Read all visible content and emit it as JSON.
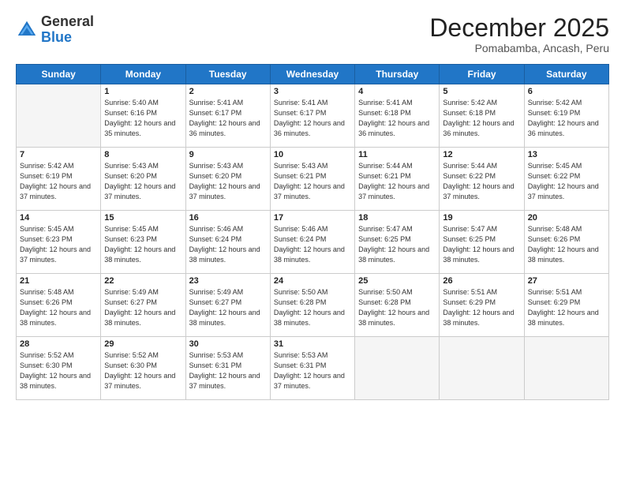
{
  "logo": {
    "general": "General",
    "blue": "Blue"
  },
  "title": "December 2025",
  "subtitle": "Pomabamba, Ancash, Peru",
  "days_of_week": [
    "Sunday",
    "Monday",
    "Tuesday",
    "Wednesday",
    "Thursday",
    "Friday",
    "Saturday"
  ],
  "weeks": [
    [
      {
        "day": "",
        "sunrise": "",
        "sunset": "",
        "daylight": ""
      },
      {
        "day": "1",
        "sunrise": "Sunrise: 5:40 AM",
        "sunset": "Sunset: 6:16 PM",
        "daylight": "Daylight: 12 hours and 35 minutes."
      },
      {
        "day": "2",
        "sunrise": "Sunrise: 5:41 AM",
        "sunset": "Sunset: 6:17 PM",
        "daylight": "Daylight: 12 hours and 36 minutes."
      },
      {
        "day": "3",
        "sunrise": "Sunrise: 5:41 AM",
        "sunset": "Sunset: 6:17 PM",
        "daylight": "Daylight: 12 hours and 36 minutes."
      },
      {
        "day": "4",
        "sunrise": "Sunrise: 5:41 AM",
        "sunset": "Sunset: 6:18 PM",
        "daylight": "Daylight: 12 hours and 36 minutes."
      },
      {
        "day": "5",
        "sunrise": "Sunrise: 5:42 AM",
        "sunset": "Sunset: 6:18 PM",
        "daylight": "Daylight: 12 hours and 36 minutes."
      },
      {
        "day": "6",
        "sunrise": "Sunrise: 5:42 AM",
        "sunset": "Sunset: 6:19 PM",
        "daylight": "Daylight: 12 hours and 36 minutes."
      }
    ],
    [
      {
        "day": "7",
        "sunrise": "Sunrise: 5:42 AM",
        "sunset": "Sunset: 6:19 PM",
        "daylight": "Daylight: 12 hours and 37 minutes."
      },
      {
        "day": "8",
        "sunrise": "Sunrise: 5:43 AM",
        "sunset": "Sunset: 6:20 PM",
        "daylight": "Daylight: 12 hours and 37 minutes."
      },
      {
        "day": "9",
        "sunrise": "Sunrise: 5:43 AM",
        "sunset": "Sunset: 6:20 PM",
        "daylight": "Daylight: 12 hours and 37 minutes."
      },
      {
        "day": "10",
        "sunrise": "Sunrise: 5:43 AM",
        "sunset": "Sunset: 6:21 PM",
        "daylight": "Daylight: 12 hours and 37 minutes."
      },
      {
        "day": "11",
        "sunrise": "Sunrise: 5:44 AM",
        "sunset": "Sunset: 6:21 PM",
        "daylight": "Daylight: 12 hours and 37 minutes."
      },
      {
        "day": "12",
        "sunrise": "Sunrise: 5:44 AM",
        "sunset": "Sunset: 6:22 PM",
        "daylight": "Daylight: 12 hours and 37 minutes."
      },
      {
        "day": "13",
        "sunrise": "Sunrise: 5:45 AM",
        "sunset": "Sunset: 6:22 PM",
        "daylight": "Daylight: 12 hours and 37 minutes."
      }
    ],
    [
      {
        "day": "14",
        "sunrise": "Sunrise: 5:45 AM",
        "sunset": "Sunset: 6:23 PM",
        "daylight": "Daylight: 12 hours and 37 minutes."
      },
      {
        "day": "15",
        "sunrise": "Sunrise: 5:45 AM",
        "sunset": "Sunset: 6:23 PM",
        "daylight": "Daylight: 12 hours and 38 minutes."
      },
      {
        "day": "16",
        "sunrise": "Sunrise: 5:46 AM",
        "sunset": "Sunset: 6:24 PM",
        "daylight": "Daylight: 12 hours and 38 minutes."
      },
      {
        "day": "17",
        "sunrise": "Sunrise: 5:46 AM",
        "sunset": "Sunset: 6:24 PM",
        "daylight": "Daylight: 12 hours and 38 minutes."
      },
      {
        "day": "18",
        "sunrise": "Sunrise: 5:47 AM",
        "sunset": "Sunset: 6:25 PM",
        "daylight": "Daylight: 12 hours and 38 minutes."
      },
      {
        "day": "19",
        "sunrise": "Sunrise: 5:47 AM",
        "sunset": "Sunset: 6:25 PM",
        "daylight": "Daylight: 12 hours and 38 minutes."
      },
      {
        "day": "20",
        "sunrise": "Sunrise: 5:48 AM",
        "sunset": "Sunset: 6:26 PM",
        "daylight": "Daylight: 12 hours and 38 minutes."
      }
    ],
    [
      {
        "day": "21",
        "sunrise": "Sunrise: 5:48 AM",
        "sunset": "Sunset: 6:26 PM",
        "daylight": "Daylight: 12 hours and 38 minutes."
      },
      {
        "day": "22",
        "sunrise": "Sunrise: 5:49 AM",
        "sunset": "Sunset: 6:27 PM",
        "daylight": "Daylight: 12 hours and 38 minutes."
      },
      {
        "day": "23",
        "sunrise": "Sunrise: 5:49 AM",
        "sunset": "Sunset: 6:27 PM",
        "daylight": "Daylight: 12 hours and 38 minutes."
      },
      {
        "day": "24",
        "sunrise": "Sunrise: 5:50 AM",
        "sunset": "Sunset: 6:28 PM",
        "daylight": "Daylight: 12 hours and 38 minutes."
      },
      {
        "day": "25",
        "sunrise": "Sunrise: 5:50 AM",
        "sunset": "Sunset: 6:28 PM",
        "daylight": "Daylight: 12 hours and 38 minutes."
      },
      {
        "day": "26",
        "sunrise": "Sunrise: 5:51 AM",
        "sunset": "Sunset: 6:29 PM",
        "daylight": "Daylight: 12 hours and 38 minutes."
      },
      {
        "day": "27",
        "sunrise": "Sunrise: 5:51 AM",
        "sunset": "Sunset: 6:29 PM",
        "daylight": "Daylight: 12 hours and 38 minutes."
      }
    ],
    [
      {
        "day": "28",
        "sunrise": "Sunrise: 5:52 AM",
        "sunset": "Sunset: 6:30 PM",
        "daylight": "Daylight: 12 hours and 38 minutes."
      },
      {
        "day": "29",
        "sunrise": "Sunrise: 5:52 AM",
        "sunset": "Sunset: 6:30 PM",
        "daylight": "Daylight: 12 hours and 37 minutes."
      },
      {
        "day": "30",
        "sunrise": "Sunrise: 5:53 AM",
        "sunset": "Sunset: 6:31 PM",
        "daylight": "Daylight: 12 hours and 37 minutes."
      },
      {
        "day": "31",
        "sunrise": "Sunrise: 5:53 AM",
        "sunset": "Sunset: 6:31 PM",
        "daylight": "Daylight: 12 hours and 37 minutes."
      },
      {
        "day": "",
        "sunrise": "",
        "sunset": "",
        "daylight": ""
      },
      {
        "day": "",
        "sunrise": "",
        "sunset": "",
        "daylight": ""
      },
      {
        "day": "",
        "sunrise": "",
        "sunset": "",
        "daylight": ""
      }
    ]
  ]
}
